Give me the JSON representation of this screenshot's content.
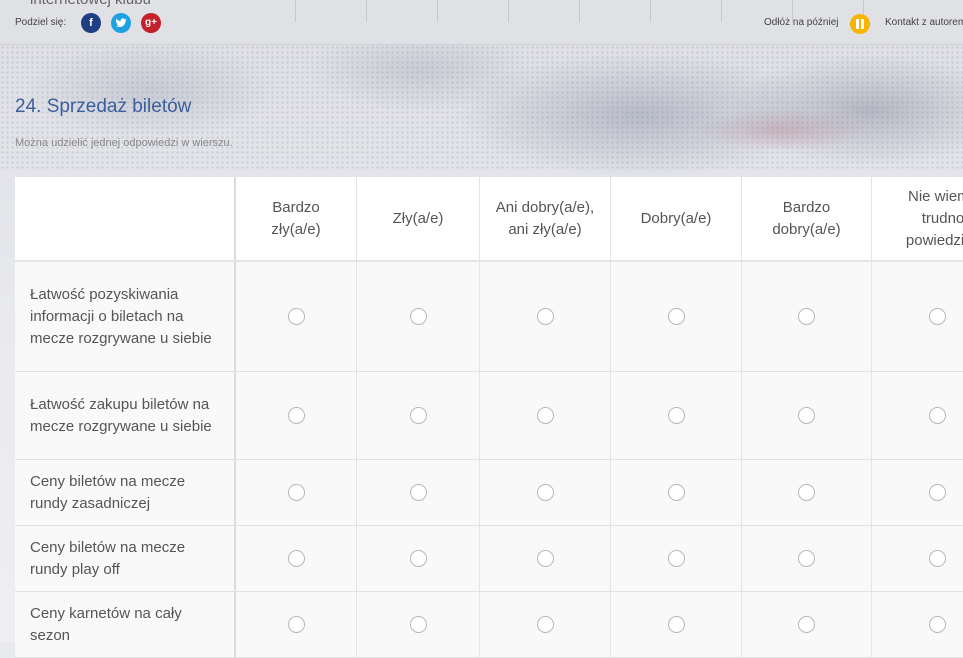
{
  "header": {
    "prev_text": "internetowej klubu",
    "share_label": "Podziel się:",
    "social": {
      "facebook": "f",
      "twitter": "twitter-icon",
      "google_plus": "g+"
    },
    "later_label": "Odłóż na później",
    "contact_label": "Kontakt z autorem",
    "colors": {
      "facebook": "#1e3f82",
      "twitter": "#1da1e0",
      "google_plus": "#c2202a",
      "pause": "#f7b500"
    }
  },
  "question": {
    "title": "24. Sprzedaż biletów",
    "hint": "Można udzielić jednej odpowiedzi w wierszu.",
    "title_color": "#3b5f9c"
  },
  "columns": [
    "Bardzo zły(a/e)",
    "Zły(a/e)",
    "Ani dobry(a/e), ani zły(a/e)",
    "Dobry(a/e)",
    "Bardzo dobry(a/e)",
    "Nie wiem / trudno powiedzieć"
  ],
  "rows": [
    "Łatwość pozyskiwania informacji o biletach na mecze rozgrywane u siebie",
    "Łatwość zakupu biletów na mecze rozgrywane u siebie",
    "Ceny biletów na mecze rundy zasadniczej",
    "Ceny biletów na mecze rundy play off",
    "Ceny karnetów na cały sezon"
  ]
}
